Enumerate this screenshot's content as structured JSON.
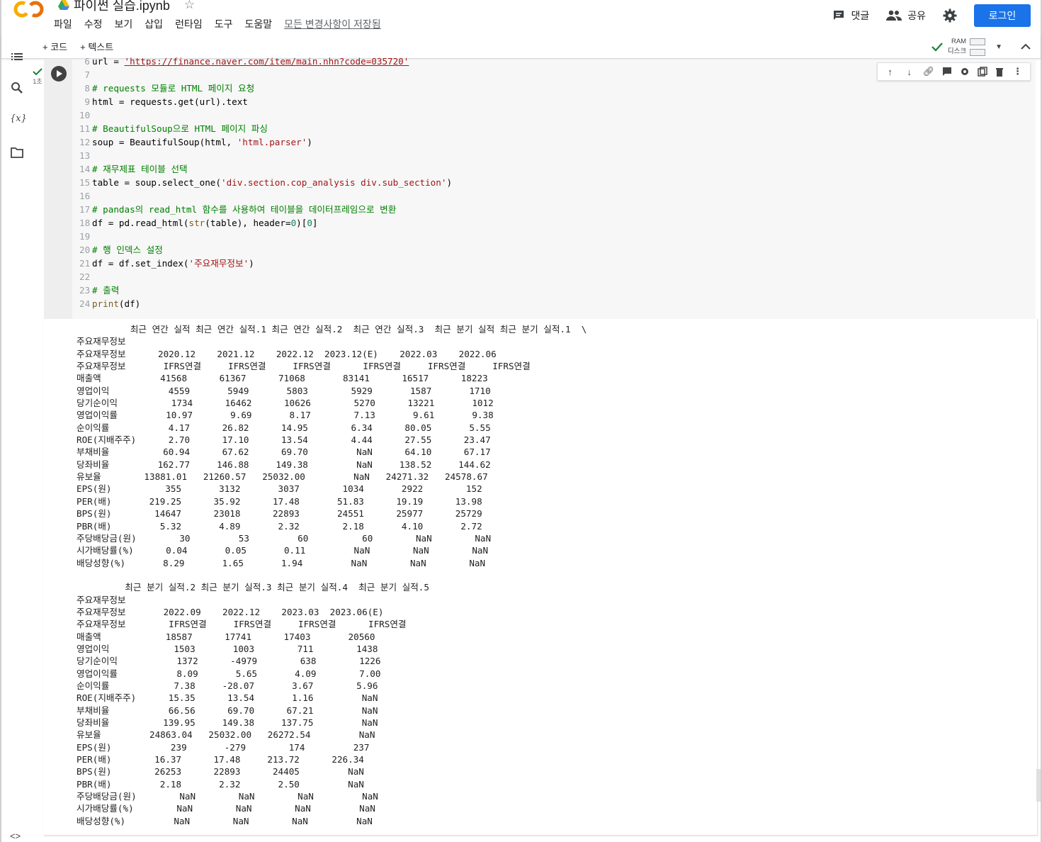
{
  "notebook": {
    "title": "파이썬 실습.ipynb",
    "menu": [
      "파일",
      "수정",
      "보기",
      "삽입",
      "런타임",
      "도구",
      "도움말"
    ],
    "save_status": "모든 변경사항이 저장됨"
  },
  "header": {
    "comment_label": "댓글",
    "share_label": "공유",
    "login_label": "로그인"
  },
  "toolbar": {
    "add_code": "+ 코드",
    "add_text": "+ 텍스트",
    "ram_label": "RAM",
    "disk_label": "디스크"
  },
  "cell": {
    "exec_time": "1초",
    "code_lines": [
      {
        "n": "6",
        "html": "url = <span class=\"url\">'https://finance.naver.com/item/main.nhn?code=035720'</span>"
      },
      {
        "n": "7",
        "html": ""
      },
      {
        "n": "8",
        "html": "<span class=\"cm\"># requests 모듈로 HTML 페이지 요청</span>"
      },
      {
        "n": "9",
        "html": "html = requests.get(url).text"
      },
      {
        "n": "10",
        "html": ""
      },
      {
        "n": "11",
        "html": "<span class=\"cm\"># BeautifulSoup으로 HTML 페이지 파싱</span>"
      },
      {
        "n": "12",
        "html": "soup = BeautifulSoup(html, <span class=\"st\">'html.parser'</span>)"
      },
      {
        "n": "13",
        "html": ""
      },
      {
        "n": "14",
        "html": "<span class=\"cm\"># 재무제표 테이블 선택</span>"
      },
      {
        "n": "15",
        "html": "table = soup.select_one(<span class=\"st\">'div.section.cop_analysis div.sub_section'</span>)"
      },
      {
        "n": "16",
        "html": ""
      },
      {
        "n": "17",
        "html": "<span class=\"cm\"># pandas의 read_html 함수를 사용하여 테이블을 데이터프레임으로 변환</span>"
      },
      {
        "n": "18",
        "html": "df = pd.read_html(<span class=\"bi\">str</span>(table), header=<span class=\"nm\">0</span>)[<span class=\"nm\">0</span>]"
      },
      {
        "n": "19",
        "html": ""
      },
      {
        "n": "20",
        "html": "<span class=\"cm\"># 행 인덱스 설정</span>"
      },
      {
        "n": "21",
        "html": "df = df.set_index(<span class=\"st\">'주요재무정보'</span>)"
      },
      {
        "n": "22",
        "html": ""
      },
      {
        "n": "23",
        "html": "<span class=\"cm\"># 출력</span>"
      },
      {
        "n": "24",
        "html": "<span class=\"bi\">print</span>(df)"
      }
    ]
  },
  "output_lines": [
    "          최근 연간 실적 최근 연간 실적.1 최근 연간 실적.2  최근 연간 실적.3  최근 분기 실적 최근 분기 실적.1  \\",
    "주요재무정보",
    "주요재무정보      2020.12    2021.12    2022.12  2023.12(E)    2022.03    2022.06",
    "주요재무정보       IFRS연결     IFRS연결     IFRS연결      IFRS연결     IFRS연결     IFRS연결",
    "매출액           41568      61367      71068       83141      16517      18223",
    "영업이익           4559       5949       5803        5929       1587       1710",
    "당기순이익          1734      16462      10626        5270      13221       1012",
    "영업이익률         10.97       9.69       8.17        7.13       9.61       9.38",
    "순이익률           4.17      26.82      14.95        6.34      80.05       5.55",
    "ROE(지배주주)      2.70      17.10      13.54        4.44      27.55      23.47",
    "부채비율          60.94      67.62      69.70         NaN      64.10      67.17",
    "당좌비율         162.77     146.88     149.38         NaN     138.52     144.62",
    "유보율        13881.01   21260.57   25032.00         NaN   24271.32   24578.67",
    "EPS(원)          355       3132       3037        1034       2922        152",
    "PER(배)       219.25      35.92      17.48       51.83      19.19      13.98",
    "BPS(원)        14647      23018      22893       24551      25977      25729",
    "PBR(배)         5.32       4.89       2.32        2.18       4.10       2.72",
    "주당배당금(원)        30         53         60          60        NaN        NaN",
    "시가배당률(%)      0.04       0.05       0.11         NaN        NaN        NaN",
    "배당성향(%)       8.29       1.65       1.94         NaN        NaN        NaN",
    "",
    "         최근 분기 실적.2 최근 분기 실적.3 최근 분기 실적.4  최근 분기 실적.5",
    "주요재무정보",
    "주요재무정보       2022.09    2022.12    2023.03  2023.06(E)",
    "주요재무정보        IFRS연결     IFRS연결     IFRS연결      IFRS연결",
    "매출액            18587      17741      17403       20560",
    "영업이익            1503       1003        711        1438",
    "당기순이익           1372      -4979        638        1226",
    "영업이익률           8.09       5.65       4.09        7.00",
    "순이익률            7.38     -28.07       3.67        5.96",
    "ROE(지배주주)      15.35      13.54       1.16         NaN",
    "부채비율           66.56      69.70      67.21         NaN",
    "당좌비율          139.95     149.38     137.75         NaN",
    "유보율         24863.04   25032.00   26272.54         NaN",
    "EPS(원)           239       -279        174         237",
    "PER(배)        16.37      17.48     213.72      226.34",
    "BPS(원)        26253      22893      24405         NaN",
    "PBR(배)         2.18       2.32       2.50         NaN",
    "주당배당금(원)        NaN        NaN        NaN         NaN",
    "시가배당률(%)        NaN        NaN        NaN         NaN",
    "배당성향(%)         NaN        NaN        NaN         NaN"
  ],
  "colors": {
    "accent": "#1a73e8",
    "logo_orange": "#f9ab00",
    "editor_bg": "#f7f7f7",
    "comment_green": "#008000",
    "string_red": "#a31515"
  }
}
